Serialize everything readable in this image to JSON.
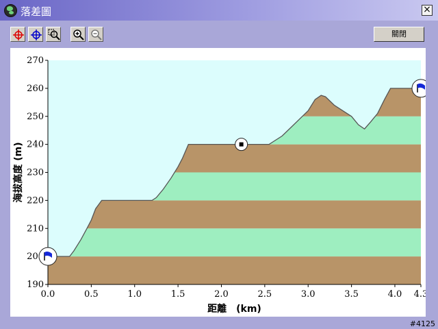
{
  "window": {
    "title": "落差圖",
    "close_glyph": "×",
    "corner_code": "#4125"
  },
  "toolbar": {
    "tools": [
      {
        "name": "start-point-tool",
        "icon": "red-crosshair-icon"
      },
      {
        "name": "end-point-tool",
        "icon": "blue-crosshair-icon"
      },
      {
        "name": "zoom-region-tool",
        "icon": "magnifier-select-icon"
      },
      {
        "name": "zoom-in-button",
        "icon": "zoom-in-icon"
      },
      {
        "name": "zoom-out-button",
        "icon": "zoom-out-icon"
      }
    ],
    "close_label": "關閉"
  },
  "colors": {
    "brown_band": "#b89468",
    "green_band": "#9eeec0",
    "sky": "#dcfdfd",
    "profile_line": "#555555"
  },
  "chart_data": {
    "type": "area",
    "xlabel": "距離　(km)",
    "ylabel": "海拔高度 (m)",
    "xlim": [
      0,
      4.3
    ],
    "ylim": [
      190,
      270
    ],
    "x_ticks": [
      "0.0",
      "0.5",
      "1.0",
      "1.5",
      "2.0",
      "2.5",
      "3.0",
      "3.5",
      "4.0",
      "4.3"
    ],
    "y_ticks": [
      "270",
      "260",
      "250",
      "240",
      "230",
      "220",
      "210",
      "200",
      "190"
    ],
    "profile": [
      [
        0,
        200
      ],
      [
        0.25,
        200
      ],
      [
        0.3,
        202
      ],
      [
        0.38,
        206
      ],
      [
        0.45,
        210
      ],
      [
        0.5,
        213
      ],
      [
        0.55,
        217
      ],
      [
        0.62,
        220
      ],
      [
        1.2,
        220
      ],
      [
        1.25,
        221
      ],
      [
        1.33,
        224
      ],
      [
        1.42,
        228
      ],
      [
        1.5,
        232
      ],
      [
        1.55,
        235
      ],
      [
        1.62,
        240
      ],
      [
        2.55,
        240
      ],
      [
        2.6,
        241
      ],
      [
        2.7,
        243
      ],
      [
        2.8,
        246
      ],
      [
        2.9,
        249
      ],
      [
        3.0,
        252
      ],
      [
        3.08,
        256
      ],
      [
        3.15,
        257.5
      ],
      [
        3.2,
        257
      ],
      [
        3.3,
        254
      ],
      [
        3.4,
        252
      ],
      [
        3.5,
        250
      ],
      [
        3.58,
        247
      ],
      [
        3.65,
        245.5
      ],
      [
        3.72,
        248
      ],
      [
        3.8,
        251
      ],
      [
        3.88,
        256
      ],
      [
        3.95,
        260
      ],
      [
        4.3,
        260
      ]
    ],
    "markers": [
      {
        "name": "start-flag",
        "x": 0,
        "y": 200
      },
      {
        "name": "midpoint-marker",
        "x": 2.23,
        "y": 240
      },
      {
        "name": "end-flag",
        "x": 4.3,
        "y": 260
      }
    ]
  }
}
